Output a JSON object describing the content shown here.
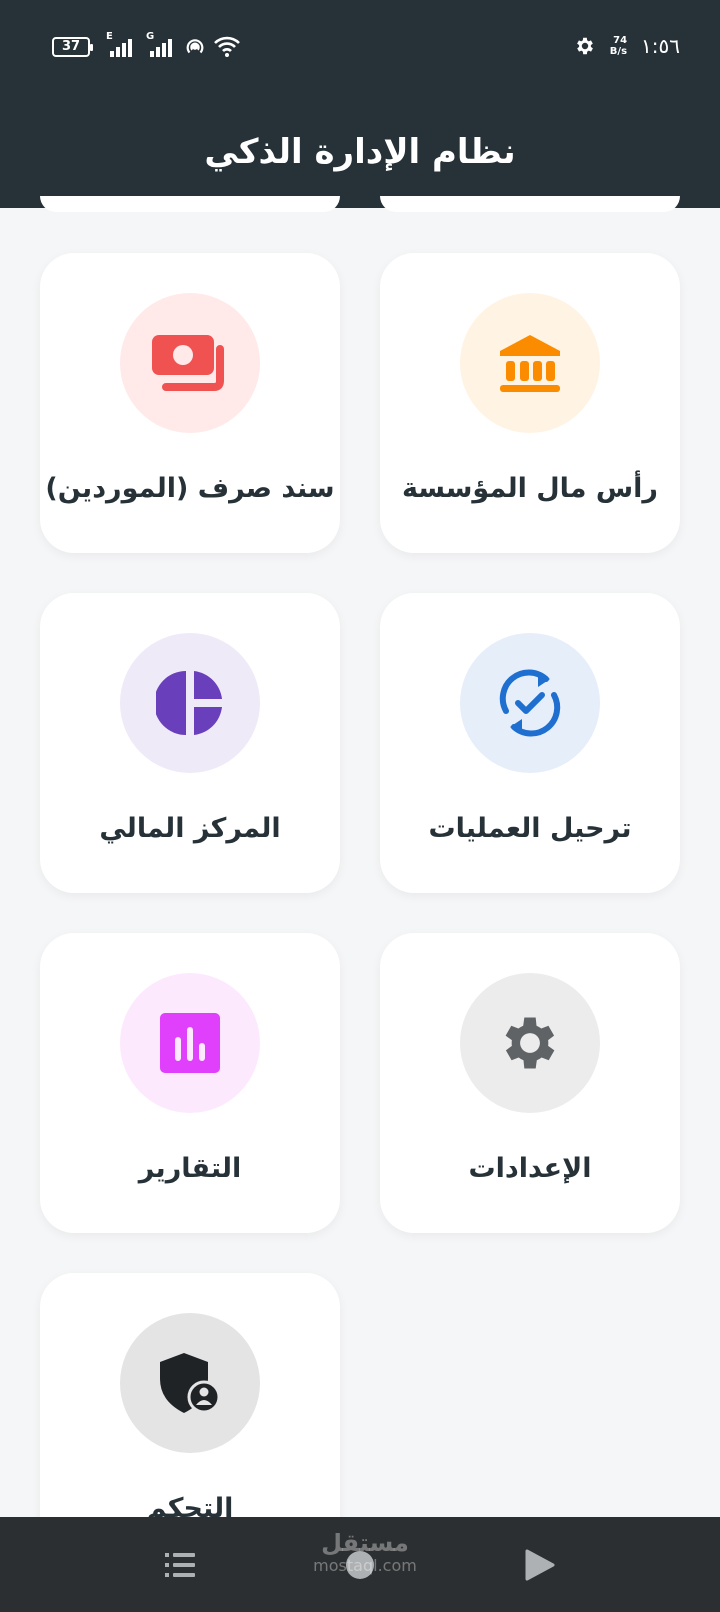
{
  "status_bar": {
    "battery": "37",
    "signal1_tag": "E",
    "signal2_tag": "G",
    "speed_value": "74",
    "speed_unit": "B/s",
    "time": "١:٥٦"
  },
  "app_bar": {
    "title": "نظام الإدارة الذكي"
  },
  "cards": [
    {
      "label": "رأس مال المؤسسة",
      "icon": "bank-icon",
      "bg": "#fff3e3",
      "color": "#fb8c00"
    },
    {
      "label": "سند صرف (الموردين)",
      "icon": "money-icon",
      "bg": "#ffe9e9",
      "color": "#f05252"
    },
    {
      "label": "ترحيل العمليات",
      "icon": "sync-check-icon",
      "bg": "#e6eef9",
      "color": "#1e6fd0"
    },
    {
      "label": "المركز المالي",
      "icon": "pie-chart-icon",
      "bg": "#efeaf8",
      "color": "#6a3fbb"
    },
    {
      "label": "الإعدادات",
      "icon": "gear-icon",
      "bg": "#ececec",
      "color": "#5f6366"
    },
    {
      "label": "التقارير",
      "icon": "bar-chart-icon",
      "bg": "#fde9fd",
      "color": "#e040fb"
    },
    {
      "label": "التحكم",
      "icon": "shield-user-icon",
      "bg": "#e4e4e4",
      "color": "#1f2326"
    }
  ],
  "bottom_nav": {
    "items": [
      {
        "icon": "menu-icon"
      },
      {
        "icon": "home-icon"
      },
      {
        "icon": "back-icon"
      }
    ],
    "watermark_ar": "مستقل",
    "watermark_en": "mostaql.com"
  }
}
